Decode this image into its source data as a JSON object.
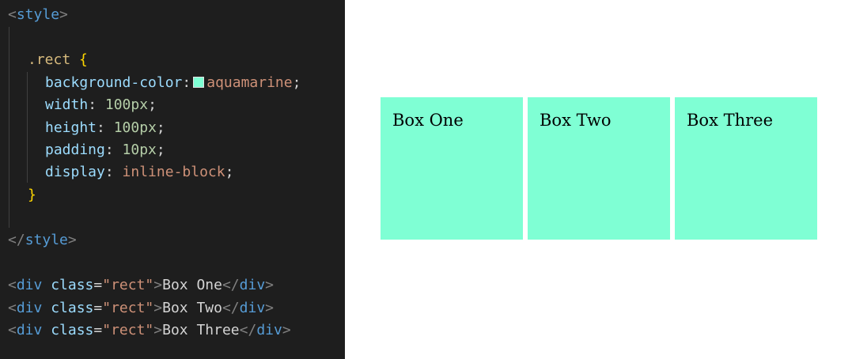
{
  "editor": {
    "style_open": {
      "lt": "<",
      "tag": "style",
      "gt": ">"
    },
    "selector": ".rect",
    "brace_open": "{",
    "brace_close": "}",
    "declarations": [
      {
        "prop": "background-color",
        "colon": ":",
        "value": "aquamarine",
        "semi": ";",
        "swatch_color": "#7fffd4"
      },
      {
        "prop": "width",
        "colon": ":",
        "value": "100px",
        "semi": ";"
      },
      {
        "prop": "height",
        "colon": ":",
        "value": "100px",
        "semi": ";"
      },
      {
        "prop": "padding",
        "colon": ":",
        "value": "10px",
        "semi": ";"
      },
      {
        "prop": "display",
        "colon": ":",
        "value": "inline-block",
        "semi": ";"
      }
    ],
    "style_close": {
      "lt": "</",
      "tag": "style",
      "gt": ">"
    },
    "divs": [
      {
        "lt": "<",
        "tag": "div",
        "attr": "class",
        "eq": "=",
        "val": "\"rect\"",
        "gt": ">",
        "text": "Box One",
        "close_lt": "</",
        "close_tag": "div",
        "close_gt": ">"
      },
      {
        "lt": "<",
        "tag": "div",
        "attr": "class",
        "eq": "=",
        "val": "\"rect\"",
        "gt": ">",
        "text": "Box Two",
        "close_lt": "</",
        "close_tag": "div",
        "close_gt": ">"
      },
      {
        "lt": "<",
        "tag": "div",
        "attr": "class",
        "eq": "=",
        "val": "\"rect\"",
        "gt": ">",
        "text": "Box Three",
        "close_lt": "</",
        "close_tag": "div",
        "close_gt": ">"
      }
    ],
    "colors": {
      "background": "#1e1e1e",
      "tag": "#569cd6",
      "property": "#9cdcfe",
      "string": "#ce9178",
      "number": "#b5cea8",
      "selector": "#d7ba7d",
      "brace": "#ffd700"
    }
  },
  "preview": {
    "box_color": "#7fffd4",
    "boxes": [
      {
        "label": "Box One"
      },
      {
        "label": "Box Two"
      },
      {
        "label": "Box Three"
      }
    ]
  }
}
